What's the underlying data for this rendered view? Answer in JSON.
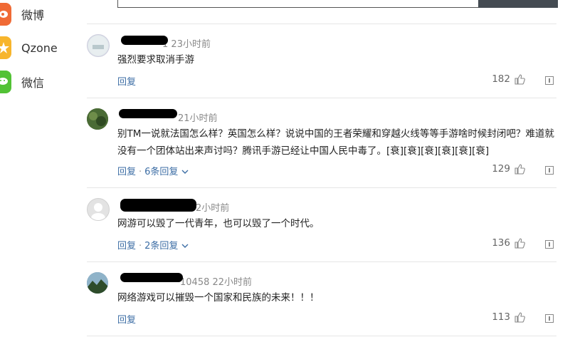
{
  "share": [
    {
      "label": "微博",
      "icon": "weibo-icon",
      "color": "#f06a35"
    },
    {
      "label": "Qzone",
      "icon": "qzone-star-icon",
      "color": "#f7b52c"
    },
    {
      "label": "微信",
      "icon": "wechat-icon",
      "color": "#52c235"
    }
  ],
  "comments": [
    {
      "user_visible": "1",
      "time": "23小时前",
      "text": "强烈要求取消手游",
      "reply_label": "回复",
      "replies": "",
      "likes": "182"
    },
    {
      "user_visible": "",
      "time": "21小时前",
      "text": "别TM一说就法国怎么样？英国怎么样？说说中国的王者荣耀和穿越火线等等手游啥时候封闭吧？难道就没有一个团体站出来声讨吗？腾讯手游已经让中国人民中毒了。[衰][衰][衰][衰][衰][衰]",
      "reply_label": "回复",
      "replies": "6条回复",
      "likes": "129"
    },
    {
      "user_visible": "",
      "time": "2小时前",
      "text": "网游可以毁了一代青年，也可以毁了一个时代。",
      "reply_label": "回复",
      "replies": "2条回复",
      "likes": "136"
    },
    {
      "user_visible": "10458",
      "time": "22小时前",
      "text": "网络游戏可以摧毁一个国家和民族的未来！！！",
      "reply_label": "回复",
      "replies": "",
      "likes": "113"
    }
  ]
}
